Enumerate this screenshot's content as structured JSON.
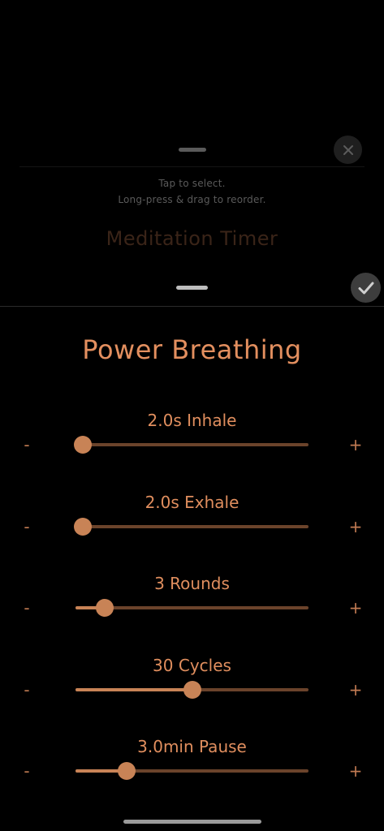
{
  "background_sheet": {
    "hint_line_1": "Tap to select.",
    "hint_line_2": "Long-press & drag to reorder.",
    "title": "Meditation Timer",
    "close_icon": "close-icon"
  },
  "front_sheet": {
    "confirm_icon": "checkmark-icon",
    "title": "Power Breathing",
    "params": [
      {
        "label": "2.0s Inhale",
        "minus": "-",
        "plus": "+",
        "level": 0.03
      },
      {
        "label": "2.0s Exhale",
        "minus": "-",
        "plus": "+",
        "level": 0.03
      },
      {
        "label": "3 Rounds",
        "minus": "-",
        "plus": "+",
        "level": 0.125
      },
      {
        "label": "30 Cycles",
        "minus": "-",
        "plus": "+",
        "level": 0.5
      },
      {
        "label": "3.0min Pause",
        "minus": "-",
        "plus": "+",
        "level": 0.22
      }
    ]
  },
  "colors": {
    "accent": "#e38f5f",
    "track": "#6b432b",
    "fill": "#c88356"
  }
}
